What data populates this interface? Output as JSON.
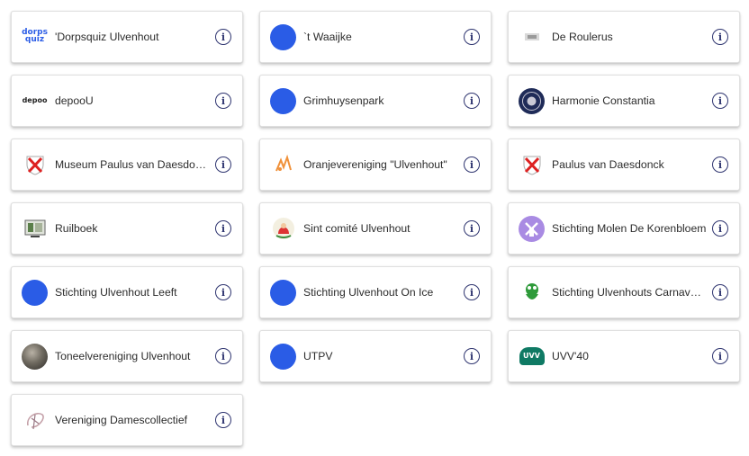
{
  "orgs": [
    {
      "name": "'Dorpsquiz Ulvenhout",
      "logo": "dorpsquiz-logo"
    },
    {
      "name": "`t Waaijke",
      "logo": "blue-dot"
    },
    {
      "name": "De Roulerus",
      "logo": "roulerus-logo"
    },
    {
      "name": "depooU",
      "logo": "depoou-logo"
    },
    {
      "name": "Grimhuysenpark",
      "logo": "blue-dot"
    },
    {
      "name": "Harmonie Constantia",
      "logo": "harmonie-logo"
    },
    {
      "name": "Museum Paulus van Daesdonck",
      "logo": "shield-cross-logo"
    },
    {
      "name": "Oranjevereniging \"Ulvenhout\"",
      "logo": "oranje-logo"
    },
    {
      "name": "Paulus van Daesdonck",
      "logo": "shield-cross-logo"
    },
    {
      "name": "Ruilboek",
      "logo": "ruilboek-logo"
    },
    {
      "name": "Sint comité Ulvenhout",
      "logo": "sint-logo"
    },
    {
      "name": "Stichting Molen De Korenbloem",
      "logo": "windmill-logo"
    },
    {
      "name": "Stichting Ulvenhout Leeft",
      "logo": "blue-dot"
    },
    {
      "name": "Stichting Ulvenhout On Ice",
      "logo": "blue-dot"
    },
    {
      "name": "Stichting Ulvenhouts Carnaval (SUC)",
      "logo": "frog-logo"
    },
    {
      "name": "Toneelvereniging Ulvenhout",
      "logo": "photo-logo"
    },
    {
      "name": "UTPV",
      "logo": "blue-dot"
    },
    {
      "name": "UVV'40",
      "logo": "uvv-logo"
    },
    {
      "name": "Vereniging Damescollectief",
      "logo": "damescollectief-logo"
    }
  ],
  "logo_text": {
    "dorpsquiz": [
      "dorps",
      "quiz"
    ],
    "depoou": "depoo",
    "uvv": "UVV"
  },
  "colors": {
    "blue_dot": "#2a5ce6",
    "info_icon": "#2f3570"
  }
}
